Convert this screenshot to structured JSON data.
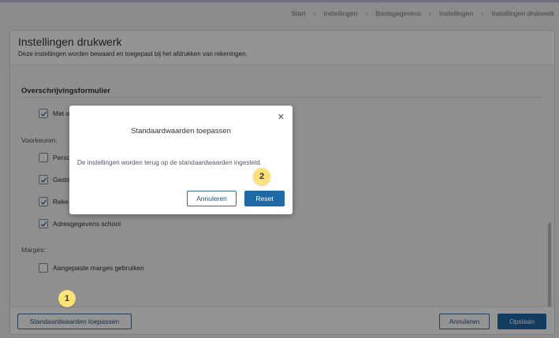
{
  "breadcrumb": [
    "Start",
    "Instellingen",
    "Basisgegevens",
    "Instellingen",
    "Instellingen drukwerk"
  ],
  "page": {
    "title": "Instellingen drukwerk",
    "subtitle": "Deze instellingen worden bewaard en toegepast bij het afdrukken van rekeningen."
  },
  "section": {
    "title": "Overschrijvingsformulier",
    "first_option": {
      "label": "Met o",
      "checked": true
    }
  },
  "voorkeuren": {
    "label": "Voorkeuren:",
    "options": [
      {
        "label": "Perso",
        "checked": false
      },
      {
        "label": "Gests",
        "checked": true
      },
      {
        "label": "Reke",
        "checked": true
      },
      {
        "label": "Adresgegevens school",
        "checked": true
      }
    ]
  },
  "marges": {
    "label": "Marges:",
    "option": {
      "label": "Aangepaste marges gebruiken",
      "checked": false
    }
  },
  "footer": {
    "defaults_label": "Standaardwaarden toepassen",
    "cancel_label": "Annuleren",
    "save_label": "Opslaan"
  },
  "modal": {
    "title": "Standaardwaarden toepassen",
    "close_glyph": "✕",
    "message": "De instellingen worden terug op de standaardwaarden ingesteld.",
    "cancel_label": "Annuleren",
    "reset_label": "Reset"
  },
  "badges": {
    "one": "1",
    "two": "2"
  },
  "colors": {
    "primary": "#1f6aa5",
    "badge": "#fde27a"
  }
}
